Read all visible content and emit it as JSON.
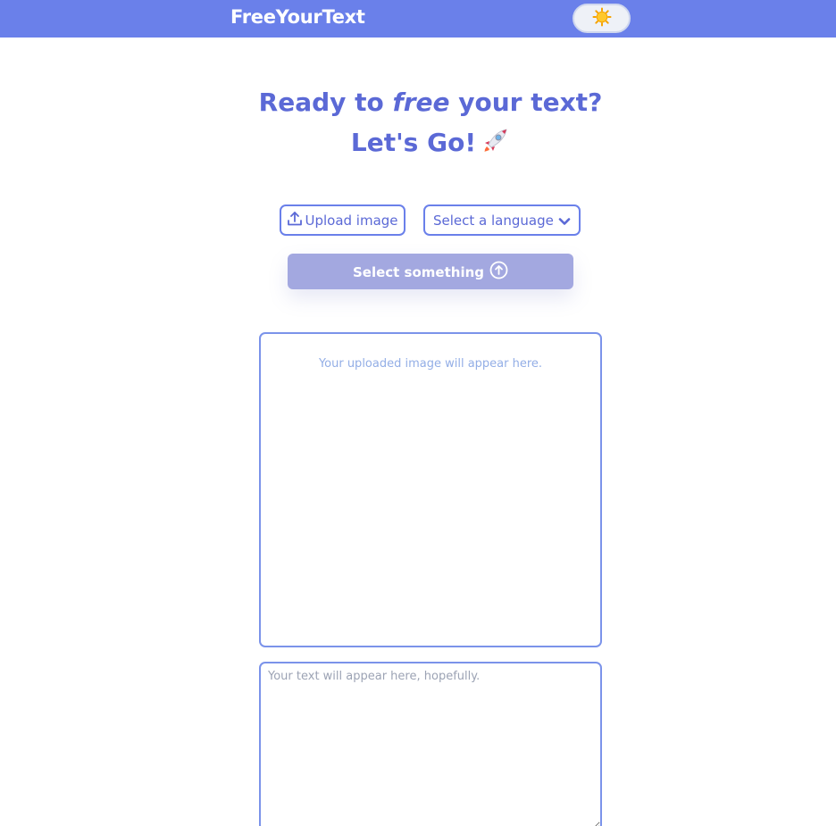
{
  "header": {
    "brand": "FreeYourText",
    "theme_toggle_icon": "sun-icon"
  },
  "hero": {
    "line1_before": "Ready to ",
    "line1_emphasis": "free",
    "line1_after": " your text?",
    "line2": "Let's Go!",
    "line2_icon": "rocket-icon"
  },
  "controls": {
    "upload_label": "Upload image",
    "upload_icon": "upload-icon",
    "language_placeholder": "Select a language",
    "language_icon": "chevron-down-icon",
    "submit_label": "Select something",
    "submit_icon": "arrow-up-circle-icon"
  },
  "image_preview": {
    "placeholder": "Your uploaded image will appear here."
  },
  "output": {
    "placeholder": "Your text will appear here, hopefully."
  },
  "colors": {
    "navbar": "#6a80ea",
    "accent": "#5b69d6",
    "submit_disabled": "#a3a8e0",
    "border": "#7b93ea"
  }
}
